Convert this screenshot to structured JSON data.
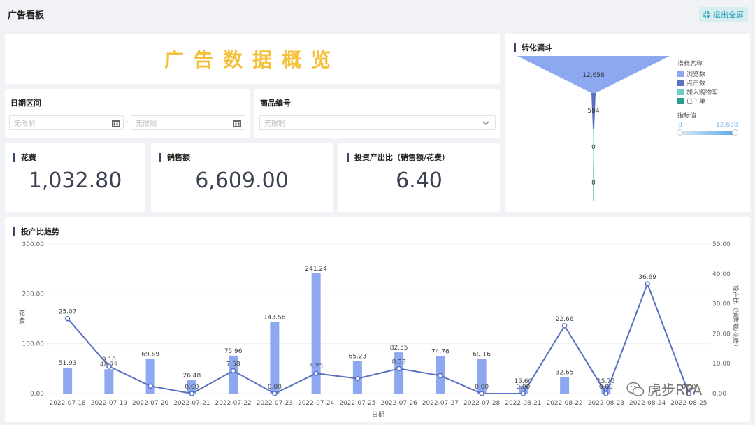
{
  "header": {
    "title": "广告看板",
    "exit_label": "退出全屏"
  },
  "banner": {
    "text": "广告数据概览",
    "color": "#f5c03a"
  },
  "filters": {
    "date": {
      "label": "日期区间",
      "start_placeholder": "无限制",
      "end_placeholder": "无限制",
      "separator": "-"
    },
    "product": {
      "label": "商品编号",
      "placeholder": "无限制"
    }
  },
  "kpis": [
    {
      "label": "花费",
      "value": "1,032.80"
    },
    {
      "label": "销售额",
      "value": "6,609.00"
    },
    {
      "label": "投资产出比（销售额/花费）",
      "value": "6.40"
    }
  ],
  "funnel": {
    "title": "转化漏斗",
    "legend_title": "指标名称",
    "legend": [
      {
        "name": "浏览数",
        "color": "#8da8f0"
      },
      {
        "name": "点击数",
        "color": "#5a70c0"
      },
      {
        "name": "加入购物车",
        "color": "#6fcfc4"
      },
      {
        "name": "已下单",
        "color": "#2a9d8f"
      }
    ],
    "stages": [
      {
        "name": "浏览数",
        "value": 12658,
        "label": "12,658"
      },
      {
        "name": "点击数",
        "value": 584,
        "label": "584"
      },
      {
        "name": "加入购物车",
        "value": 0,
        "label": "0"
      },
      {
        "name": "已下单",
        "value": 0,
        "label": "0"
      }
    ],
    "range_title": "指标值",
    "range_min": "0",
    "range_max": "12,658"
  },
  "trend": {
    "title": "投产比趋势",
    "watermark": "虎步RPA",
    "colors": {
      "bar": "#8da8f0",
      "line": "#5a70c0"
    }
  },
  "chart_data": {
    "type": "bar",
    "title": "投产比趋势",
    "xlabel": "日期",
    "ylabel": "花费",
    "y2label": "投产比（销售额/花费）",
    "ylim": [
      0,
      300
    ],
    "y2lim": [
      0,
      50
    ],
    "yticks": [
      "0.00",
      "100.00",
      "200.00",
      "300.00"
    ],
    "y2ticks": [
      "0.00",
      "10.00",
      "20.00",
      "30.00",
      "40.00",
      "50.00"
    ],
    "categories": [
      "2022-07-18",
      "2022-07-19",
      "2022-07-20",
      "2022-07-21",
      "2022-07-22",
      "2022-07-23",
      "2022-07-24",
      "2022-07-25",
      "2022-07-26",
      "2022-07-27",
      "2022-07-28",
      "2022-08-21",
      "2022-08-22",
      "2022-08-23",
      "2022-08-24",
      "2022-08-25"
    ],
    "series": [
      {
        "name": "花费",
        "type": "bar",
        "axis": "left",
        "values": [
          51.93,
          48.79,
          69.69,
          26.48,
          75.96,
          143.58,
          241.24,
          65.23,
          82.55,
          74.76,
          69.16,
          15.6,
          32.65,
          15.75,
          0,
          0
        ],
        "labels": [
          "51.93",
          "48.79",
          "69.69",
          "26.48",
          "75.96",
          "143.58",
          "241.24",
          "65.23",
          "82.55",
          "74.76",
          "69.16",
          "15.60",
          "32.65",
          "15.75",
          "",
          ""
        ]
      },
      {
        "name": "投产比（销售额/花费）",
        "type": "line",
        "axis": "right",
        "values": [
          25.07,
          9.1,
          2.5,
          0.0,
          7.58,
          0.0,
          6.73,
          5.0,
          8.33,
          6.0,
          0.0,
          0.0,
          22.66,
          0.0,
          36.69,
          0.0
        ],
        "labels": [
          "25.07",
          "9.10",
          "",
          "0.00",
          "7.58",
          "0.00",
          "6.73",
          "",
          "8.33",
          "",
          "0.00",
          "0.00",
          "22.66",
          "0.00",
          "36.69",
          "0.00"
        ]
      }
    ]
  }
}
